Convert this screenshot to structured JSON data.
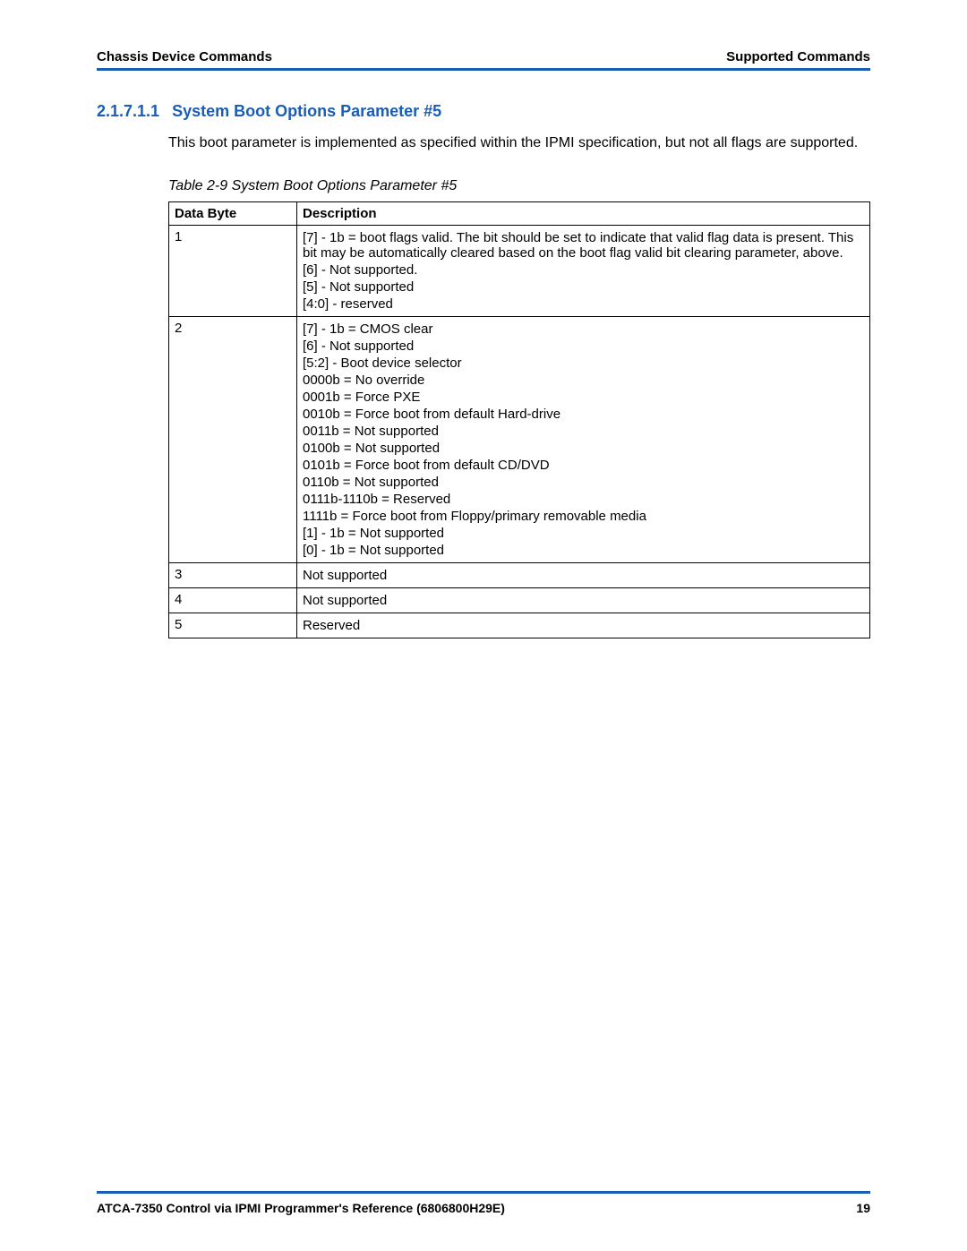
{
  "header": {
    "left": "Chassis Device Commands",
    "right": "Supported Commands"
  },
  "section": {
    "number": "2.1.7.1.1",
    "title": "System Boot Options Parameter #5"
  },
  "intro": "This boot parameter is implemented as specified within the IPMI specification, but not all flags are supported.",
  "table": {
    "caption": "Table 2-9 System Boot Options Parameter #5",
    "headers": {
      "col1": "Data Byte",
      "col2": "Description"
    },
    "rows": [
      {
        "byte": "1",
        "lines": [
          "[7] - 1b = boot flags valid. The bit should be set to indicate that valid flag data is present. This bit may be automatically cleared based on the boot flag valid bit clearing parameter, above.",
          "[6] - Not supported.",
          "[5] - Not supported",
          "[4:0] - reserved"
        ]
      },
      {
        "byte": "2",
        "lines": [
          "[7] - 1b = CMOS clear",
          "[6] - Not supported",
          "[5:2] - Boot device selector",
          "0000b = No override",
          "0001b = Force PXE",
          "0010b = Force boot from default Hard-drive",
          "0011b = Not supported",
          "0100b = Not supported",
          "0101b = Force boot from default CD/DVD",
          "0110b = Not supported",
          "0111b-1110b = Reserved",
          "1111b = Force boot from Floppy/primary removable media",
          "[1] - 1b = Not supported",
          "[0] - 1b = Not supported"
        ]
      },
      {
        "byte": "3",
        "lines": [
          "Not supported"
        ]
      },
      {
        "byte": "4",
        "lines": [
          "Not supported"
        ]
      },
      {
        "byte": "5",
        "lines": [
          "Reserved"
        ]
      }
    ]
  },
  "footer": {
    "left": "ATCA-7350 Control via IPMI Programmer's Reference (6806800H29E)",
    "page": "19"
  }
}
